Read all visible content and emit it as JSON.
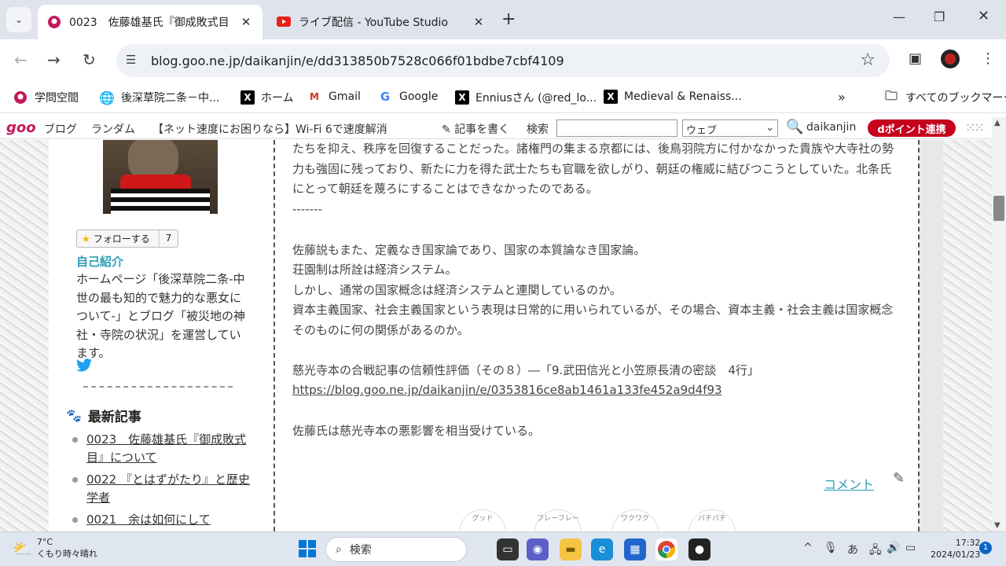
{
  "browser": {
    "tabs": [
      {
        "title": "0023　佐藤雄基氏『御成敗式目",
        "active": true,
        "icon": "goo-favicon"
      },
      {
        "title": "ライブ配信 - YouTube Studio",
        "active": false,
        "icon": "youtube-favicon"
      }
    ],
    "url": "blog.goo.ne.jp/daikanjin/e/dd313850b7528c066f01bdbe7cbf4109",
    "bookmarks": [
      {
        "label": "学問空間",
        "icon": "goo-favicon"
      },
      {
        "label": "後深草院二条－中...",
        "icon": "globe-icon"
      },
      {
        "label": "ホーム",
        "icon": "x-icon"
      },
      {
        "label": "Gmail",
        "icon": "gmail-icon"
      },
      {
        "label": "Google",
        "icon": "google-icon"
      },
      {
        "label": "Enniusさん (@red_lo...",
        "icon": "x-icon"
      },
      {
        "label": "Medieval & Renaiss...",
        "icon": "x-icon"
      }
    ],
    "all_bookmarks": "すべてのブックマーク"
  },
  "goobar": {
    "logo": "goo",
    "blog": "ブログ",
    "random": "ランダム",
    "promo": "【ネット速度にお困りなら】Wi-Fi 6で速度解消",
    "write": "記事を書く",
    "search_label": "検索",
    "search_value": "",
    "scope": "ウェブ",
    "username": "daikanjin",
    "dpoint": "dポイント連携"
  },
  "sidebar": {
    "follow_label": "フォローする",
    "follow_count": "7",
    "self_heading": "自己紹介",
    "self_text": "ホームページ「後深草院二条-中世の最も知的で魅力的な悪女について-」とブログ「被災地の神社・寺院の状況」を運営しています。",
    "latest_heading": "最新記事",
    "latest": [
      "0023　佐藤雄基氏『御成敗式目』について",
      "0022 『とはずがたり』と歴史学者",
      "0021　余は如何にして"
    ]
  },
  "article": {
    "p1": "たちを抑え、秩序を回復することだった。諸権門の集まる京都には、後鳥羽院方に付かなかった貴族や大寺社の勢力も強固に残っており、新たに力を得た武士たちも官職を欲しがり、朝廷の権威に結びつこうとしていた。北条氏にとって朝廷を蔑ろにすることはできなかったのである。",
    "sep": "-------",
    "p2": "佐藤説もまた、定義なき国家論であり、国家の本質論なき国家論。",
    "p3": "荘園制は所詮は経済システム。",
    "p4": "しかし、通常の国家概念は経済システムと連関しているのか。",
    "p5": "資本主義国家、社会主義国家という表現は日常的に用いられているが、その場合、資本主義・社会主義は国家概念そのものに何の関係があるのか。",
    "p6": "慈光寺本の合戦記事の信頼性評価（その８）―「9.武田信光と小笠原長清の密談　4行」",
    "link": "https://blog.goo.ne.jp/daikanjin/e/0353816ce8ab1461a133fe452a9d4f93",
    "p7": "佐藤氏は慈光寺本の悪影響を相当受けている。",
    "comment": "コメント",
    "reactions": [
      "グッド",
      "フレーフレー",
      "ワクワク",
      "パチパチ"
    ]
  },
  "taskbar": {
    "temp": "7°C",
    "weather": "くもり時々晴れ",
    "search": "検索",
    "time": "17:32",
    "date": "2024/01/23",
    "notifications": "1",
    "ime": "あ"
  }
}
